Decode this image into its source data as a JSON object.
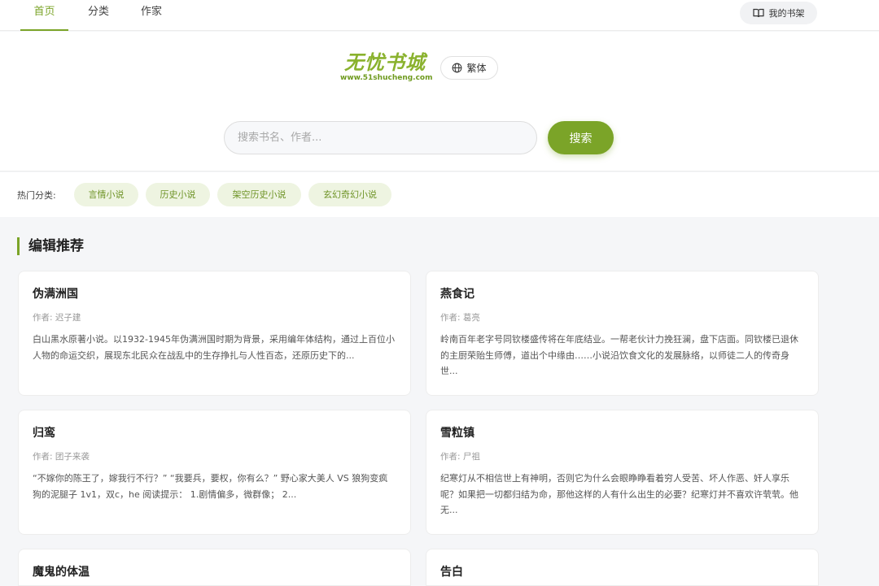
{
  "nav": {
    "tabs": [
      {
        "label": "首页",
        "active": true
      },
      {
        "label": "分类",
        "active": false
      },
      {
        "label": "作家",
        "active": false
      }
    ],
    "shelf_label": "我的书架",
    "shelf_icon": "book-open-icon"
  },
  "header": {
    "logo_text": "无忧书城",
    "logo_url": "www.51shucheng.com",
    "lang_label": "繁体",
    "lang_icon": "globe-icon",
    "search_placeholder": "搜索书名、作者...",
    "search_button": "搜索"
  },
  "hot": {
    "label": "热门分类:",
    "tags": [
      "言情小说",
      "历史小说",
      "架空历史小说",
      "玄幻奇幻小说"
    ]
  },
  "section": {
    "title": "编辑推荐"
  },
  "books": [
    {
      "title": "伪满洲国",
      "author": "作者: 迟子建",
      "desc": "白山黑水原著小说。以1932-1945年伪满洲国时期为背景，采用编年体结构，通过上百位小人物的命运交织，展现东北民众在战乱中的生存挣扎与人性百态，还原历史下的..."
    },
    {
      "title": "燕食记",
      "author": "作者: 葛亮",
      "desc": "岭南百年老字号同钦楼盛传将在年底结业。一帮老伙计力挽狂澜，盘下店面。同钦楼已退休的主厨荣贻生师傅，道出个中缘由……小说沿饮食文化的发展脉络，以师徒二人的传奇身世..."
    },
    {
      "title": "归鸾",
      "author": "作者: 团子来袭",
      "desc": "“不嫁你的陈王了，嫁我行不行？” “我要兵，要权，你有么？” 野心家大美人 VS 狼狗变疯狗的泥腿子 1v1，双c，he 阅读提示： 1.剧情偏多，微群像； 2..."
    },
    {
      "title": "雪粒镇",
      "author": "作者: 尸祖",
      "desc": "纪寒灯从不相信世上有神明，否则它为什么会眼睁睁看着穷人受苦、坏人作恶、奸人享乐呢？如果把一切都归结为命，那他这样的人有什么出生的必要？纪寒灯并不喜欢许茕茕。他无..."
    },
    {
      "title": "魔鬼的体温",
      "author": "",
      "desc": ""
    },
    {
      "title": "告白",
      "author": "",
      "desc": ""
    }
  ],
  "colors": {
    "accent": "#7ba428",
    "tag_bg": "#eef4e1",
    "page_bg": "#f5f6f8"
  }
}
